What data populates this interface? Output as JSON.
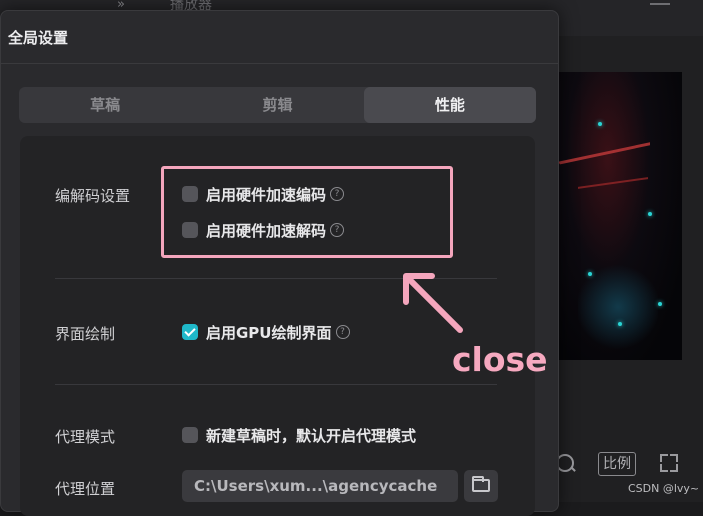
{
  "background": {
    "player_title": "播放器",
    "collapse_glyph": "»",
    "ratio_label": "比例"
  },
  "dialog": {
    "title": "全局设置",
    "tabs": [
      {
        "label": "草稿",
        "active": false
      },
      {
        "label": "剪辑",
        "active": false
      },
      {
        "label": "性能",
        "active": true
      }
    ],
    "codec": {
      "label": "编解码设置",
      "hw_encode": {
        "label": "启用硬件加速编码",
        "checked": false
      },
      "hw_decode": {
        "label": "启用硬件加速解码",
        "checked": false
      }
    },
    "render": {
      "label": "界面绘制",
      "gpu": {
        "label": "启用GPU绘制界面",
        "checked": true
      }
    },
    "proxy": {
      "mode_label": "代理模式",
      "mode_option": {
        "label": "新建草稿时，默认开启代理模式",
        "checked": false
      },
      "location_label": "代理位置",
      "location_value": "C:\\Users\\xum...\\agencycache"
    },
    "help_glyph": "?"
  },
  "annotation": {
    "close_text": "close",
    "color": "#f4a6bd"
  },
  "watermark": "CSDN @lvy~",
  "colors": {
    "accent": "#1fb8c9",
    "annotation": "#f4a6bd"
  }
}
